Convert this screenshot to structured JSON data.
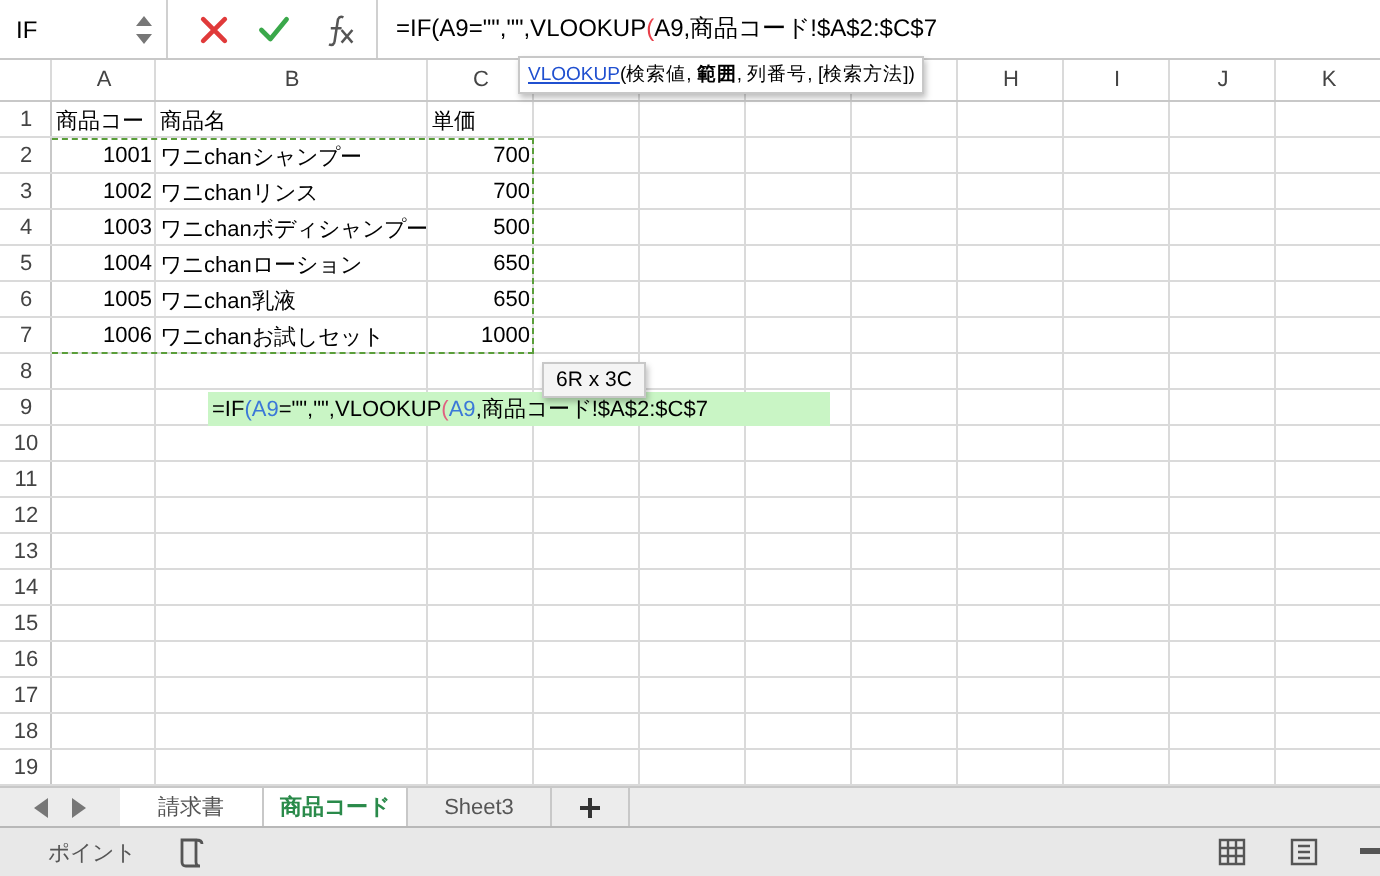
{
  "name_box": {
    "value": "IF"
  },
  "formula_bar": {
    "segments": [
      {
        "text": "=IF(A9=\"\",\"\",VLOOKUP",
        "color": "#000000"
      },
      {
        "text": "(",
        "color": "#e8404a"
      },
      {
        "text": "A9,商品コード!$A$2:$C$7",
        "color": "#000000"
      }
    ]
  },
  "function_tooltip": {
    "function": "VLOOKUP",
    "arguments": "(検索値, **範囲**, 列番号, [検索方法])"
  },
  "columns_left": [
    "A",
    "B",
    "C"
  ],
  "columns_right": [
    "H",
    "I",
    "J",
    "K"
  ],
  "rows": [
    {
      "number": "1",
      "cells": [
        {
          "text": "商品コー",
          "kind": "text"
        },
        {
          "text": "商品名",
          "kind": "text"
        },
        {
          "text": "単価",
          "kind": "text"
        }
      ]
    },
    {
      "number": "2",
      "cells": [
        {
          "text": "1001",
          "kind": "number"
        },
        {
          "text": "ワニchanシャンプー",
          "kind": "text"
        },
        {
          "text": "700",
          "kind": "number"
        }
      ]
    },
    {
      "number": "3",
      "cells": [
        {
          "text": "1002",
          "kind": "number"
        },
        {
          "text": "ワニchanリンス",
          "kind": "text"
        },
        {
          "text": "700",
          "kind": "number"
        }
      ]
    },
    {
      "number": "4",
      "cells": [
        {
          "text": "1003",
          "kind": "number"
        },
        {
          "text": "ワニchanボディシャンプー",
          "kind": "text"
        },
        {
          "text": "500",
          "kind": "number"
        }
      ]
    },
    {
      "number": "5",
      "cells": [
        {
          "text": "1004",
          "kind": "number"
        },
        {
          "text": "ワニchanローション",
          "kind": "text"
        },
        {
          "text": "650",
          "kind": "number"
        }
      ]
    },
    {
      "number": "6",
      "cells": [
        {
          "text": "1005",
          "kind": "number"
        },
        {
          "text": "ワニchan乳液",
          "kind": "text"
        },
        {
          "text": "650",
          "kind": "number"
        }
      ]
    },
    {
      "number": "7",
      "cells": [
        {
          "text": "1006",
          "kind": "number"
        },
        {
          "text": "ワニchanお試しセット",
          "kind": "text"
        },
        {
          "text": "1000",
          "kind": "number"
        }
      ]
    },
    {
      "number": "8"
    },
    {
      "number": "9"
    },
    {
      "number": "10"
    },
    {
      "number": "11"
    },
    {
      "number": "12"
    },
    {
      "number": "13"
    },
    {
      "number": "14"
    },
    {
      "number": "15"
    },
    {
      "number": "16"
    },
    {
      "number": "17"
    },
    {
      "number": "18"
    },
    {
      "number": "19"
    }
  ],
  "cell_editor": {
    "segments": [
      {
        "text": "=IF",
        "color": "#000000"
      },
      {
        "text": "(A9",
        "color": "#3b78d8"
      },
      {
        "text": "=\"\",\"\",VLOOKUP",
        "color": "#000000"
      },
      {
        "text": "(",
        "color": "#e06080"
      },
      {
        "text": "A9",
        "color": "#3b78d8"
      },
      {
        "text": ",商品コード!$A$2:$C$7",
        "color": "#000000"
      }
    ]
  },
  "range_tooltip": "6R x 3C",
  "sheet_tabs": [
    {
      "label": "請求書",
      "selected": false
    },
    {
      "label": "商品コード",
      "selected": true
    },
    {
      "label": "Sheet3",
      "selected": false
    }
  ],
  "status_bar": {
    "mode": "ポイント"
  }
}
